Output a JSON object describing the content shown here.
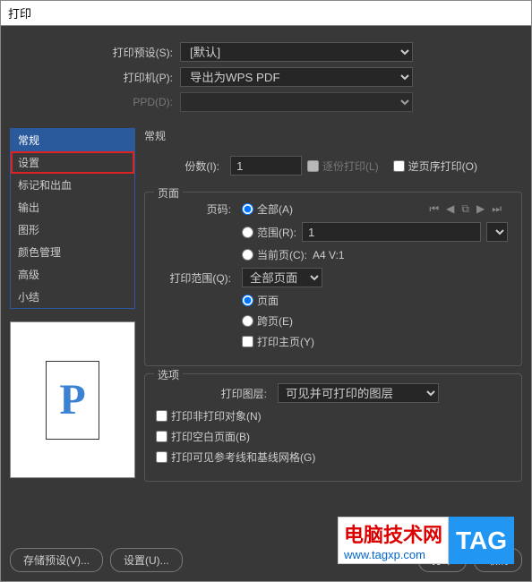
{
  "window": {
    "title": "打印"
  },
  "top": {
    "preset_label": "打印预设(S):",
    "preset_value": "[默认]",
    "printer_label": "打印机(P):",
    "printer_value": "导出为WPS PDF",
    "ppd_label": "PPD(D):",
    "ppd_value": ""
  },
  "sidebar": {
    "items": [
      {
        "label": "常规"
      },
      {
        "label": "设置"
      },
      {
        "label": "标记和出血"
      },
      {
        "label": "输出"
      },
      {
        "label": "图形"
      },
      {
        "label": "颜色管理"
      },
      {
        "label": "高级"
      },
      {
        "label": "小结"
      }
    ]
  },
  "preview": {
    "glyph": "P"
  },
  "content": {
    "section_title": "常规",
    "copies": {
      "label": "份数(I):",
      "value": "1",
      "collate_label": "逐份打印(L)",
      "reverse_label": "逆页序打印(O)"
    },
    "pages": {
      "group_label": "页面",
      "page_number_label": "页码:",
      "all_label": "全部(A)",
      "range_label": "范围(R):",
      "range_value": "1",
      "current_label": "当前页(C):",
      "current_info": "A4 V:1",
      "scope_label": "打印范围(Q):",
      "scope_value": "全部页面",
      "page_opt": "页面",
      "spread_opt": "跨页(E)",
      "master_label": "打印主页(Y)"
    },
    "options": {
      "group_label": "选项",
      "layers_label": "打印图层:",
      "layers_value": "可见并可打印的图层",
      "nonprint_label": "打印非打印对象(N)",
      "blank_label": "打印空白页面(B)",
      "guides_label": "打印可见参考线和基线网格(G)"
    }
  },
  "buttons": {
    "save_preset": "存储预设(V)...",
    "setup": "设置(U)...",
    "print": "打印",
    "cancel": "取消"
  },
  "watermark": {
    "title": "电脑技术网",
    "url": "www.tagxp.com",
    "tag": "TAG"
  }
}
